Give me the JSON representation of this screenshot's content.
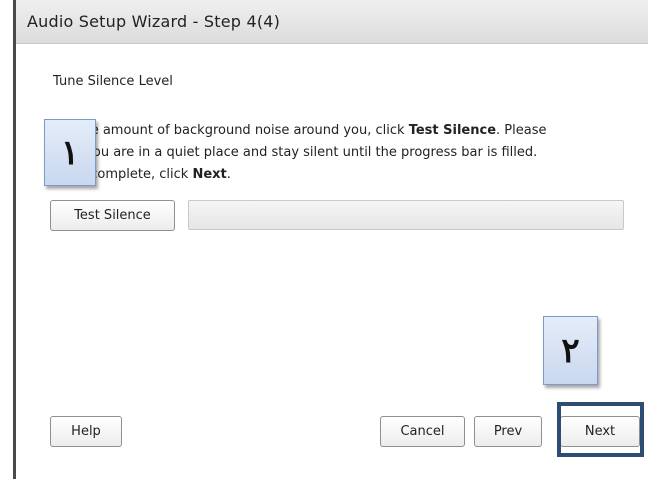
{
  "window": {
    "title": "Audio Setup Wizard - Step 4(4)"
  },
  "content": {
    "heading": "Tune Silence Level",
    "instruction_lines": [
      {
        "pre": "ect the amount of background noise around you, click ",
        "bold": "Test Silence",
        "post": ". Please"
      },
      {
        "pre": "sure you are in a quiet place and stay silent until the progress bar is filled.",
        "bold": "",
        "post": ""
      },
      {
        "pre": "his is complete, click ",
        "bold": "Next",
        "post": "."
      }
    ],
    "test_silence_label": "Test Silence",
    "progress_fraction": 0
  },
  "footer": {
    "help_label": "Help",
    "cancel_label": "Cancel",
    "prev_label": "Prev",
    "next_label": "Next"
  },
  "callouts": {
    "step1": "١",
    "step2": "٢"
  },
  "colors": {
    "callout_fill": "#d6e2f4",
    "highlight_border": "#2e4d75"
  }
}
